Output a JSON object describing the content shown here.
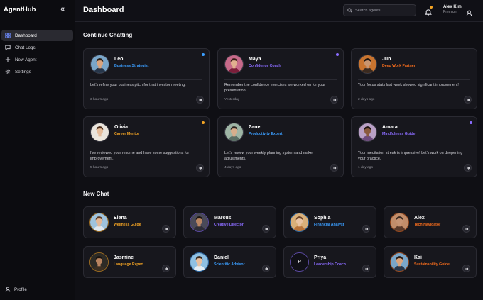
{
  "sidebar": {
    "brand": "AgentHub",
    "items": [
      {
        "label": "Dashboard",
        "icon": "grid-icon",
        "active": true
      },
      {
        "label": "Chat Logs",
        "icon": "chat-bubble-icon"
      },
      {
        "label": "New Agent",
        "icon": "plus-icon"
      },
      {
        "label": "Settings",
        "icon": "gear-icon"
      }
    ],
    "profile_label": "Profile"
  },
  "header": {
    "title": "Dashboard",
    "search_placeholder": "Search agents...",
    "user_name": "Alex Kim",
    "user_plan": "Premium",
    "notification_badge_color": "#f5a524"
  },
  "continue": {
    "title": "Continue Chatting",
    "cards": [
      {
        "name": "Leo",
        "role": "Business Strategist",
        "role_color": "#3b9eff",
        "dot_color": "#3b9eff",
        "message": "Let's refine your business pitch for that investor meeting.",
        "time": "3 hours ago"
      },
      {
        "name": "Maya",
        "role": "Confidence Coach",
        "role_color": "#8b6cff",
        "dot_color": "#8b6cff",
        "message": "Remember the confidence exercises we worked on for your presentation.",
        "time": "Yesterday"
      },
      {
        "name": "Jun",
        "role": "Deep Work Partner",
        "role_color": "#f26b1d",
        "dot_color": "",
        "message": "Your focus stats last week showed significant improvement!",
        "time": "2 days ago"
      },
      {
        "name": "Olivia",
        "role": "Career Mentor",
        "role_color": "#f5a524",
        "dot_color": "#f5a524",
        "message": "I've reviewed your resume and have some suggestions for improvement.",
        "time": "5 hours ago"
      },
      {
        "name": "Zane",
        "role": "Productivity Expert",
        "role_color": "#3b9eff",
        "dot_color": "",
        "message": "Let's review your weekly planning system and make adjustments.",
        "time": "4 days ago"
      },
      {
        "name": "Amara",
        "role": "Mindfulness Guide",
        "role_color": "#8b6cff",
        "dot_color": "#8b6cff",
        "message": "Your meditation streak is impressive! Let's work on deepening your practice.",
        "time": "1 day ago"
      }
    ]
  },
  "new_chat": {
    "title": "New Chat",
    "agents": [
      {
        "name": "Elena",
        "role": "Wellness Guide",
        "role_color": "#f5a524"
      },
      {
        "name": "Marcus",
        "role": "Creative Director",
        "role_color": "#8b6cff"
      },
      {
        "name": "Sophia",
        "role": "Financial Analyst",
        "role_color": "#3b9eff"
      },
      {
        "name": "Alex",
        "role": "Tech Navigator",
        "role_color": "#f26b1d"
      },
      {
        "name": "Jasmine",
        "role": "Language Expert",
        "role_color": "#f5a524"
      },
      {
        "name": "Daniel",
        "role": "Scientific Advisor",
        "role_color": "#3b9eff"
      },
      {
        "name": "Priya",
        "role": "Leadership Coach",
        "role_color": "#8b6cff",
        "initial": "P"
      },
      {
        "name": "Kai",
        "role": "Sustainability Guide",
        "role_color": "#f26b1d"
      }
    ]
  }
}
